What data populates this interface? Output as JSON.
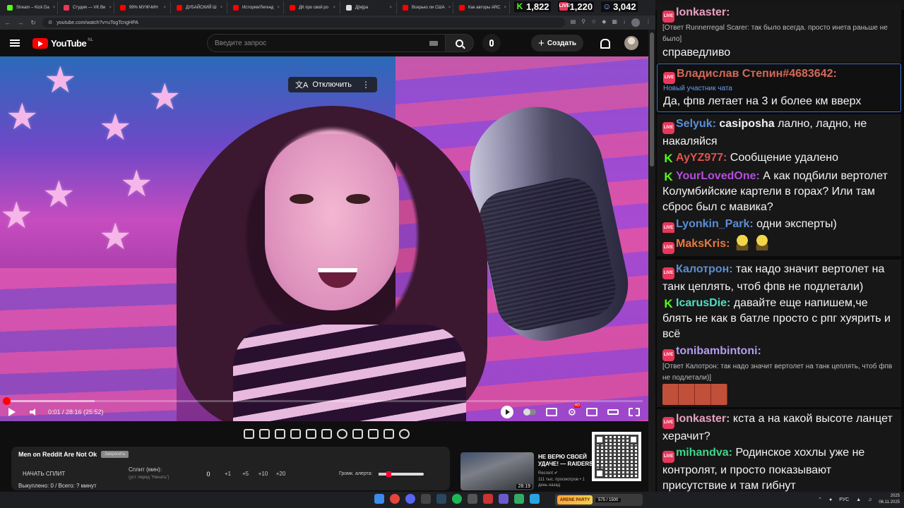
{
  "browser": {
    "tabs": [
      {
        "title": "Stream – Kick Da",
        "color": "#53fc18"
      },
      {
        "title": "Студия — VK Ви",
        "color": "#e8375b"
      },
      {
        "title": "99% МУЖЧИН",
        "color": "#ff0000"
      },
      {
        "title": "ДУБАЙСКИЙ Ш",
        "color": "#ff0000"
      },
      {
        "title": "История/Легенд",
        "color": "#ff0000"
      },
      {
        "title": "ДК про свой ро",
        "color": "#ff0000"
      },
      {
        "title": "Д[м]ра",
        "color": "#dddddd"
      },
      {
        "title": "Всерьез ли США",
        "color": "#ff0000"
      },
      {
        "title": "Как авторы ARC",
        "color": "#ff0000"
      }
    ],
    "url": "youtube.com/watch?v=uTogTcngHPA"
  },
  "stream_stats": {
    "kick_viewers": "1,822",
    "vk_viewers": "1,220",
    "total_viewers": "3,042"
  },
  "youtube": {
    "logo_text": "YouTube",
    "region": "NL",
    "search_placeholder": "Введите запрос",
    "create_label": "Создать",
    "subtitle_toggle": "Отключить",
    "time_display": "0:01 / 28:16 (25:52)",
    "progress_fraction": 0.001,
    "buffer_fraction": 0.14
  },
  "split_panel": {
    "title": "Men on Reddit Are Not Ok",
    "badge": "Запросить",
    "start_button": "НАЧАТЬ СПЛИТ",
    "split_label": "Сплит (мин):",
    "split_hint": "(уст. перед \"Начать\")",
    "split_value": "0",
    "increments": [
      "+1",
      "+5",
      "+10",
      "+20"
    ],
    "alert_label": "Громк. алерта:",
    "alert_volume_fraction": 0.18,
    "footer": "Выкуплено: 0 / Всего: ? минут"
  },
  "recommendation": {
    "title": "НЕ ВЕРЮ СВОЕЙ УДАЧЕ! — RAIDERS",
    "channel": "Recrent",
    "meta": "111 тыс. просмотров • 1 день назад",
    "duration": "28:19"
  },
  "chat": {
    "messages": [
      {
        "platform": "live",
        "nick": "lonkaster:",
        "nick_color": "#e8a0c0",
        "reply": "[Ответ Runnerregal Scarer: так было всегда. просто инета раньше не было]",
        "text": "справедливо"
      },
      {
        "platform": "live",
        "nick": "Владислав Степин#4683642:",
        "nick_color": "#d2695a",
        "badge": "Новый участник чата",
        "text": "Да, фпв летает на 3 и более км вверх",
        "highlight": true
      },
      {
        "platform": "live",
        "nick": "Selyuk:",
        "nick_color": "#5a8ed6",
        "bold_text": "casiposha",
        "text": "лално, ладно, не накаляйся"
      },
      {
        "platform": "kick",
        "nick": "AyYZ977:",
        "nick_color": "#e0534e",
        "text": "Сообщение удалено"
      },
      {
        "platform": "kick",
        "nick": "YourLovedOne:",
        "nick_color": "#b44de0",
        "text": "А как подбили вертолет Колумбийские картели в горах? Или там сброс был с мавика?"
      },
      {
        "platform": "live",
        "nick": "Lyonkin_Park:",
        "nick_color": "#5a8ed6",
        "text": "одни эксперты)"
      },
      {
        "platform": "live",
        "nick": "MaksKris:",
        "nick_color": "#e8793f",
        "emotes": 2,
        "text": ""
      },
      {
        "platform": "live",
        "nick": "Калотрон:",
        "nick_color": "#5a8ed6",
        "text": "так надо значит вертолет на танк цеплять, чтоб фпв не подлетали)"
      },
      {
        "platform": "kick",
        "nick": "IcarusDie:",
        "nick_color": "#4fe0c0",
        "text": "давайте еще напишем,че блять не как в батле просто с рпг хуярить и всё"
      },
      {
        "platform": "live",
        "nick": "tonibambintoni:",
        "nick_color": "#b49cf0",
        "reply": "[Ответ Калотрон: так надо значит вертолет на танк цеплять, чтоб фпв не подлетали)]",
        "emote_strip": true,
        "text": ""
      },
      {
        "platform": "live",
        "nick": "lonkaster:",
        "nick_color": "#e8a0c0",
        "text": "кста а на какой высоте ланцет херачит?"
      },
      {
        "platform": "live",
        "nick": "mihandva:",
        "nick_color": "#3fd68a",
        "text": "Родинское хохлы уже не контролят, и просто показывают присутствие и там гибнут"
      }
    ]
  },
  "taskbar": {
    "lang": "РУС",
    "time": "2025",
    "date": "06.11.2025",
    "game_logo": "ARENE PARTY",
    "game_score": "575 / 1500"
  },
  "icons": {
    "kick": "kick-logo-icon",
    "vk_live": "vk-live-icon",
    "viewers": "person-icon"
  }
}
